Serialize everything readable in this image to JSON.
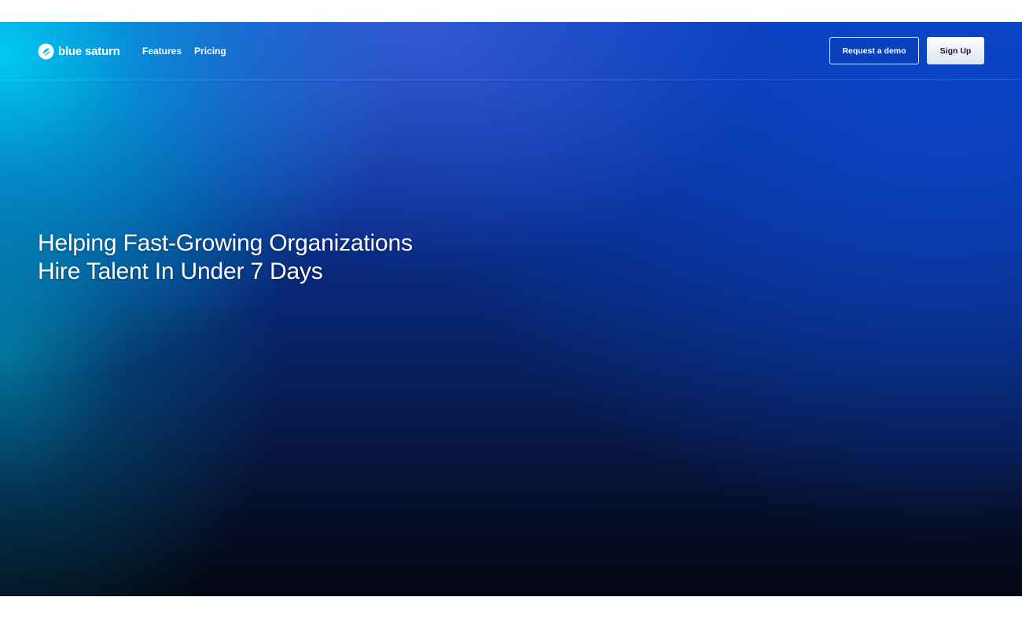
{
  "brand": {
    "name": "blue saturn",
    "logo_icon": "saturn-logo-icon"
  },
  "nav": {
    "links": [
      {
        "label": "Features"
      },
      {
        "label": "Pricing"
      }
    ]
  },
  "actions": {
    "demo_label": "Request a demo",
    "signup_label": "Sign Up"
  },
  "hero": {
    "headline_line1": "Helping Fast-Growing Organizations",
    "headline_line2": "Hire Talent In Under 7 Days"
  },
  "colors": {
    "accent_cyan": "#00d2f5",
    "primary_blue": "#0a3fbd",
    "deep_navy": "#030812"
  }
}
